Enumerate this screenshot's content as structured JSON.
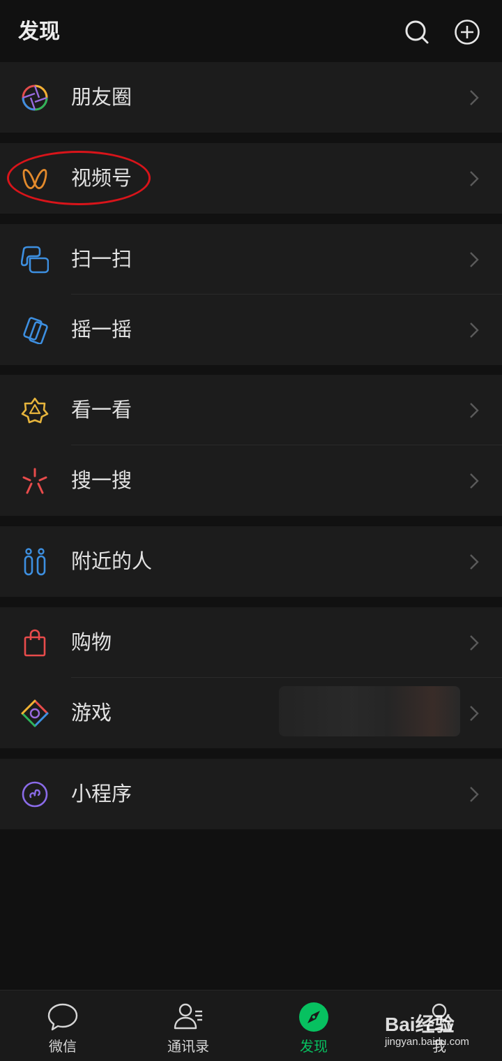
{
  "header": {
    "title": "发现",
    "search_icon": "search-icon",
    "add_icon": "add-circle-icon"
  },
  "menu": {
    "moments": "朋友圈",
    "channels": "视频号",
    "scan": "扫一扫",
    "shake": "摇一摇",
    "top_stories": "看一看",
    "search": "搜一搜",
    "people_nearby": "附近的人",
    "shopping": "购物",
    "games": "游戏",
    "mini_programs": "小程序"
  },
  "tabs": [
    {
      "label": "微信",
      "icon": "chat-bubble-icon"
    },
    {
      "label": "通讯录",
      "icon": "contacts-icon"
    },
    {
      "label": "发现",
      "icon": "compass-icon",
      "active": true
    },
    {
      "label": "我",
      "icon": "person-icon"
    }
  ],
  "watermark": {
    "brand": "Bai经验",
    "url": "jingyan.baidu.com"
  },
  "colors": {
    "accent": "#07c160",
    "annotation": "#d8141a",
    "background": "#111111",
    "cell": "#1c1c1c"
  }
}
